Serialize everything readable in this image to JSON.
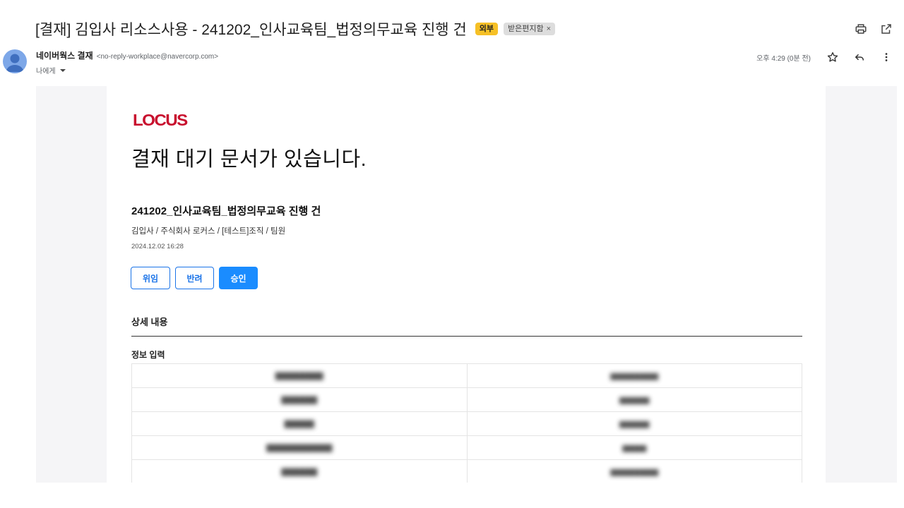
{
  "email": {
    "subject": "[결재] 김입사 리소스사용 - 241202_인사교육팀_법정의무교육 진행 건",
    "labels": {
      "external": "외부",
      "inbox": "받은편지함",
      "inbox_remove": "×"
    },
    "sender_name": "네이버웍스 결재",
    "sender_email": "<no-reply-workplace@navercorp.com>",
    "recipient": "나에게",
    "timestamp": "오후 4:29 (0분 전)"
  },
  "icons": {
    "print": "printer-icon",
    "open_new": "open-in-new-window-icon",
    "star": "star-icon",
    "reply": "reply-icon",
    "more": "more-vertical-icon",
    "avatar": "person-avatar-icon"
  },
  "body": {
    "logo": "LOCUS",
    "headline": "결재 대기 문서가 있습니다.",
    "doc_title": "241202_인사교육팀_법정의무교육 진행 건",
    "drafter": "김입사 / 주식회사 로커스 / [테스트]조직 / 팀원",
    "doc_date": "2024.12.02 16:28",
    "buttons": {
      "delegate": "위임",
      "reject": "반려",
      "approve": "승인"
    },
    "section_title": "상세 내용",
    "subsection_title": "정보 입력"
  },
  "colors": {
    "logo_red": "#c8102e",
    "primary_blue": "#1a8cff",
    "outline_blue": "#1a73e8",
    "external_badge": "#f6c026"
  }
}
